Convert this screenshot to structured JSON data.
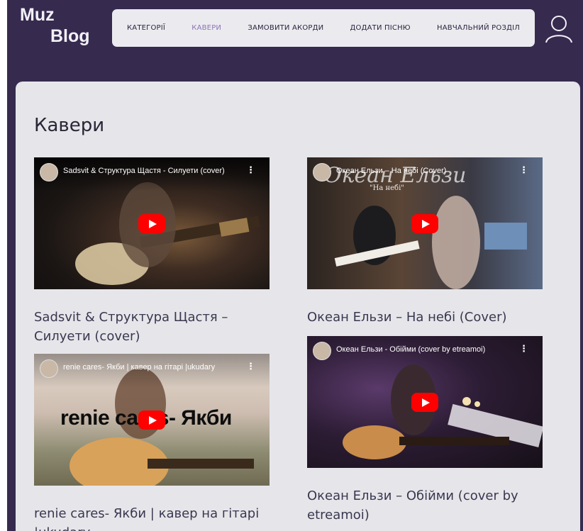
{
  "logo": {
    "line1": "Muz",
    "line2": "Blog"
  },
  "nav": {
    "items": [
      {
        "label": "КАТЕГОРІЇ",
        "active": false
      },
      {
        "label": "КАВЕРИ",
        "active": true
      },
      {
        "label": "ЗАМОВИТИ АКОРДИ",
        "active": false
      },
      {
        "label": "ДОДАТИ ПІСНЮ",
        "active": false
      },
      {
        "label": "НАВЧАЛЬНИЙ РОЗДІЛ",
        "active": false
      }
    ]
  },
  "user_icon": "user-icon",
  "page_title": "Кавери",
  "videos": [
    {
      "embed_title": "Sadsvit & Структура Щастя - Силуети (cover)",
      "caption": "Sadsvit & Структура Щастя – Силуети (cover)",
      "overlay": ""
    },
    {
      "embed_title": "Океан Ельзи – На небі (Cover)",
      "caption": "Океан Ельзи – На небі (Cover)",
      "overlay_script": "Океан Ельзи",
      "overlay_sub": "\"На небі\""
    },
    {
      "embed_title": "renie cares- Якби | кавер на гітарі |ukudary",
      "caption": "renie cares- Якби | кавер на гітарі |ukudary",
      "overlay": "renie cares- Якби"
    },
    {
      "embed_title": "Океан Ельзи - Обійми (cover by etreamoi)",
      "caption": "Океан Ельзи – Обійми (cover by etreamoi)",
      "overlay": ""
    }
  ],
  "colors": {
    "header_bg": "#362a4f",
    "nav_bg": "#ebebef",
    "nav_active": "#8e74b6",
    "panel_bg": "#e6e6ea",
    "play_button": "#ff0000"
  }
}
